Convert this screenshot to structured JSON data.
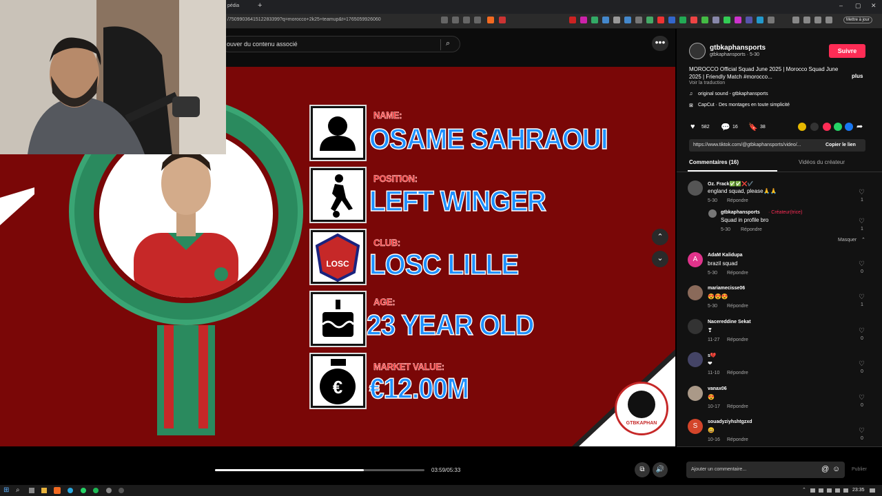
{
  "browser": {
    "tab_title": "pédia",
    "url": "/7509903641512283399?q=morocco+2k25+teamup&t=1765059926060",
    "update_button": "Mettre à jour"
  },
  "search": {
    "placeholder": "ouver du contenu associé"
  },
  "card": {
    "name_label": "NAME:",
    "name_value": "OSAME SAHRAOUI",
    "position_label": "POSITION:",
    "position_value": "LEFT WINGER",
    "club_label": "CLUB:",
    "club_value": "LOSC LILLE",
    "club_logo_text": "LOSC",
    "age_label": "AGE:",
    "age_value": "23 YEAR OLD",
    "market_label": "MARKET VALUE:",
    "market_value": "€12.00M",
    "watermark": "GTBKAPHAN"
  },
  "player": {
    "time": "03:59/05:33",
    "progress": 0.71
  },
  "panel": {
    "account": "gtbkaphansports",
    "account_sub": "gtbkaphansports · 5-30",
    "follow": "Suivre",
    "description": "MOROCCO Official Squad June 2025 | Morocco Squad June 2025 | Friendly Match #morocco...",
    "more": "plus",
    "translate": "Voir la traduction",
    "sound": "original sound - gtbkaphansports",
    "capcut": "CapCut · Des montages en toute simplicité",
    "likes": "582",
    "comments_count": "16",
    "saves": "38",
    "link": "https://www.tiktok.com/@gtbkaphansports/video/...",
    "copy_link": "Copier le lien",
    "tab_comments": "Commentaires (16)",
    "tab_videos": "Vidéos du créateur",
    "hide": "Masquer",
    "add_comment": "Ajouter un commentaire...",
    "publish": "Publier",
    "reply": "Répondre",
    "comments": [
      {
        "user": "Oz. Frack✅✅❌✔️",
        "text": "england squad, please🙏🙏",
        "date": "5-30",
        "likes": "1",
        "avatar_color": "#555"
      },
      {
        "user": "gtbkaphansports",
        "creator": "· Créateur(trice)",
        "text": "Squad in profile bro",
        "date": "5-30",
        "likes": "1",
        "avatar_color": "#777"
      },
      {
        "user": "AdaM Kalidupa",
        "text": "brazil squad",
        "date": "5-30",
        "likes": "0",
        "avatar_color": "#e0338b",
        "initial": "A"
      },
      {
        "user": "mariamecisse06",
        "text": "😍😍😍",
        "date": "5-30",
        "likes": "1",
        "avatar_color": "#8a6a5a"
      },
      {
        "user": "Nacereddine Sekat",
        "text": "❣",
        "date": "11-27",
        "likes": "0",
        "avatar_color": "#333"
      },
      {
        "user": "s💔",
        "text": "❤",
        "date": "11-10",
        "likes": "0",
        "avatar_color": "#446"
      },
      {
        "user": "vanax06",
        "text": "😍",
        "date": "10-17",
        "likes": "0",
        "avatar_color": "#a98"
      },
      {
        "user": "souadyziyhshtgzxd",
        "text": "😀",
        "date": "10-16",
        "likes": "0",
        "avatar_color": "#d3452a",
        "initial": "S"
      }
    ]
  },
  "taskbar": {
    "time": "23:35"
  }
}
